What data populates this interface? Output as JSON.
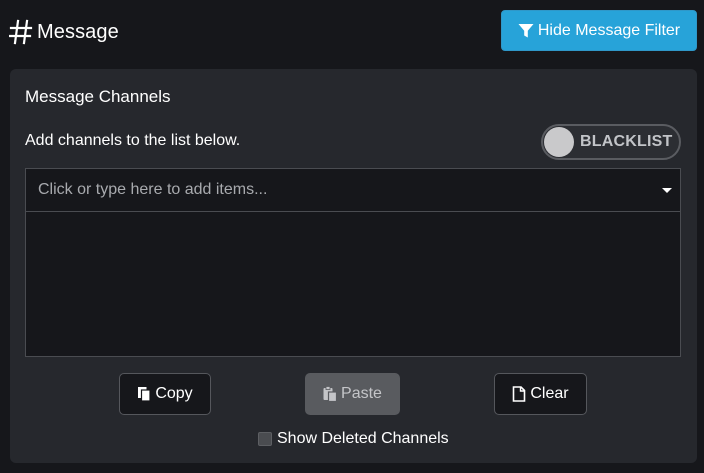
{
  "header": {
    "title": "Message",
    "title_icon": "hash-icon",
    "filter_button": {
      "label": "Hide Message Filter",
      "icon": "filter-icon",
      "color": "#27a3d9"
    }
  },
  "panel": {
    "title": "Message Channels",
    "hint": "Add channels to the list below.",
    "mode_toggle": {
      "label": "BLACKLIST",
      "state": "off"
    },
    "channel_input": {
      "placeholder": "Click or type here to add items..."
    },
    "channels": [],
    "buttons": {
      "copy": {
        "label": "Copy",
        "icon": "copy-icon"
      },
      "paste": {
        "label": "Paste",
        "icon": "paste-icon",
        "disabled": true
      },
      "clear": {
        "label": "Clear",
        "icon": "file-icon"
      }
    },
    "show_deleted": {
      "label": "Show Deleted Channels",
      "checked": false
    }
  }
}
